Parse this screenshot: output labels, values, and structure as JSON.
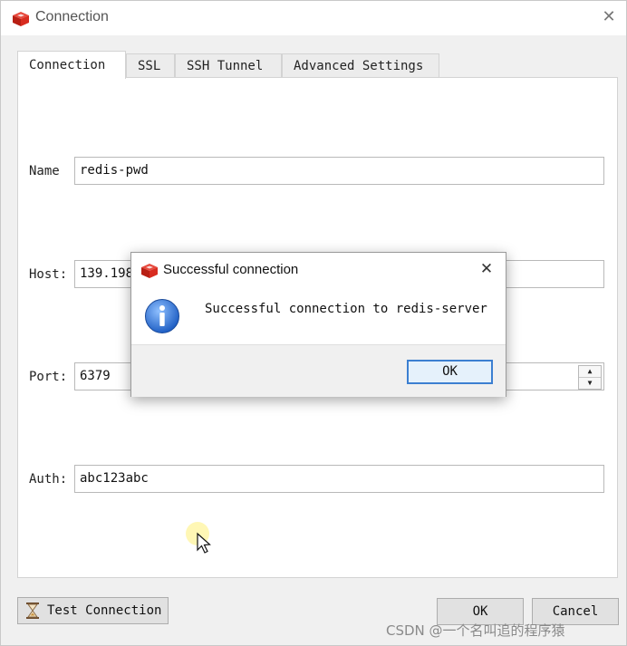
{
  "window": {
    "title": "Connection",
    "close_icon": "close-icon",
    "app_icon": "redis-logo-icon"
  },
  "tabs": [
    {
      "label": "Connection",
      "active": true
    },
    {
      "label": "SSL",
      "active": false
    },
    {
      "label": "SSH Tunnel",
      "active": false
    },
    {
      "label": "Advanced Settings",
      "active": false
    }
  ],
  "form": {
    "name": {
      "label": "Name",
      "value": "redis-pwd"
    },
    "host": {
      "label": "Host:",
      "value": "139.198"
    },
    "port": {
      "label": "Port:",
      "value": "6379"
    },
    "auth": {
      "label": "Auth:",
      "value": "abc123abc"
    }
  },
  "buttons": {
    "test_connection": "Test Connection",
    "ok": "OK",
    "cancel": "Cancel"
  },
  "dialog": {
    "title": "Successful connection",
    "message": "Successful connection to redis-server",
    "ok_label": "OK",
    "icon": "info-icon"
  },
  "watermark": "CSDN @一个名叫追的程序猿",
  "colors": {
    "redis_red": "#d82c20",
    "info_blue": "#1f5fc4",
    "focus_border": "#3c7fd1"
  }
}
